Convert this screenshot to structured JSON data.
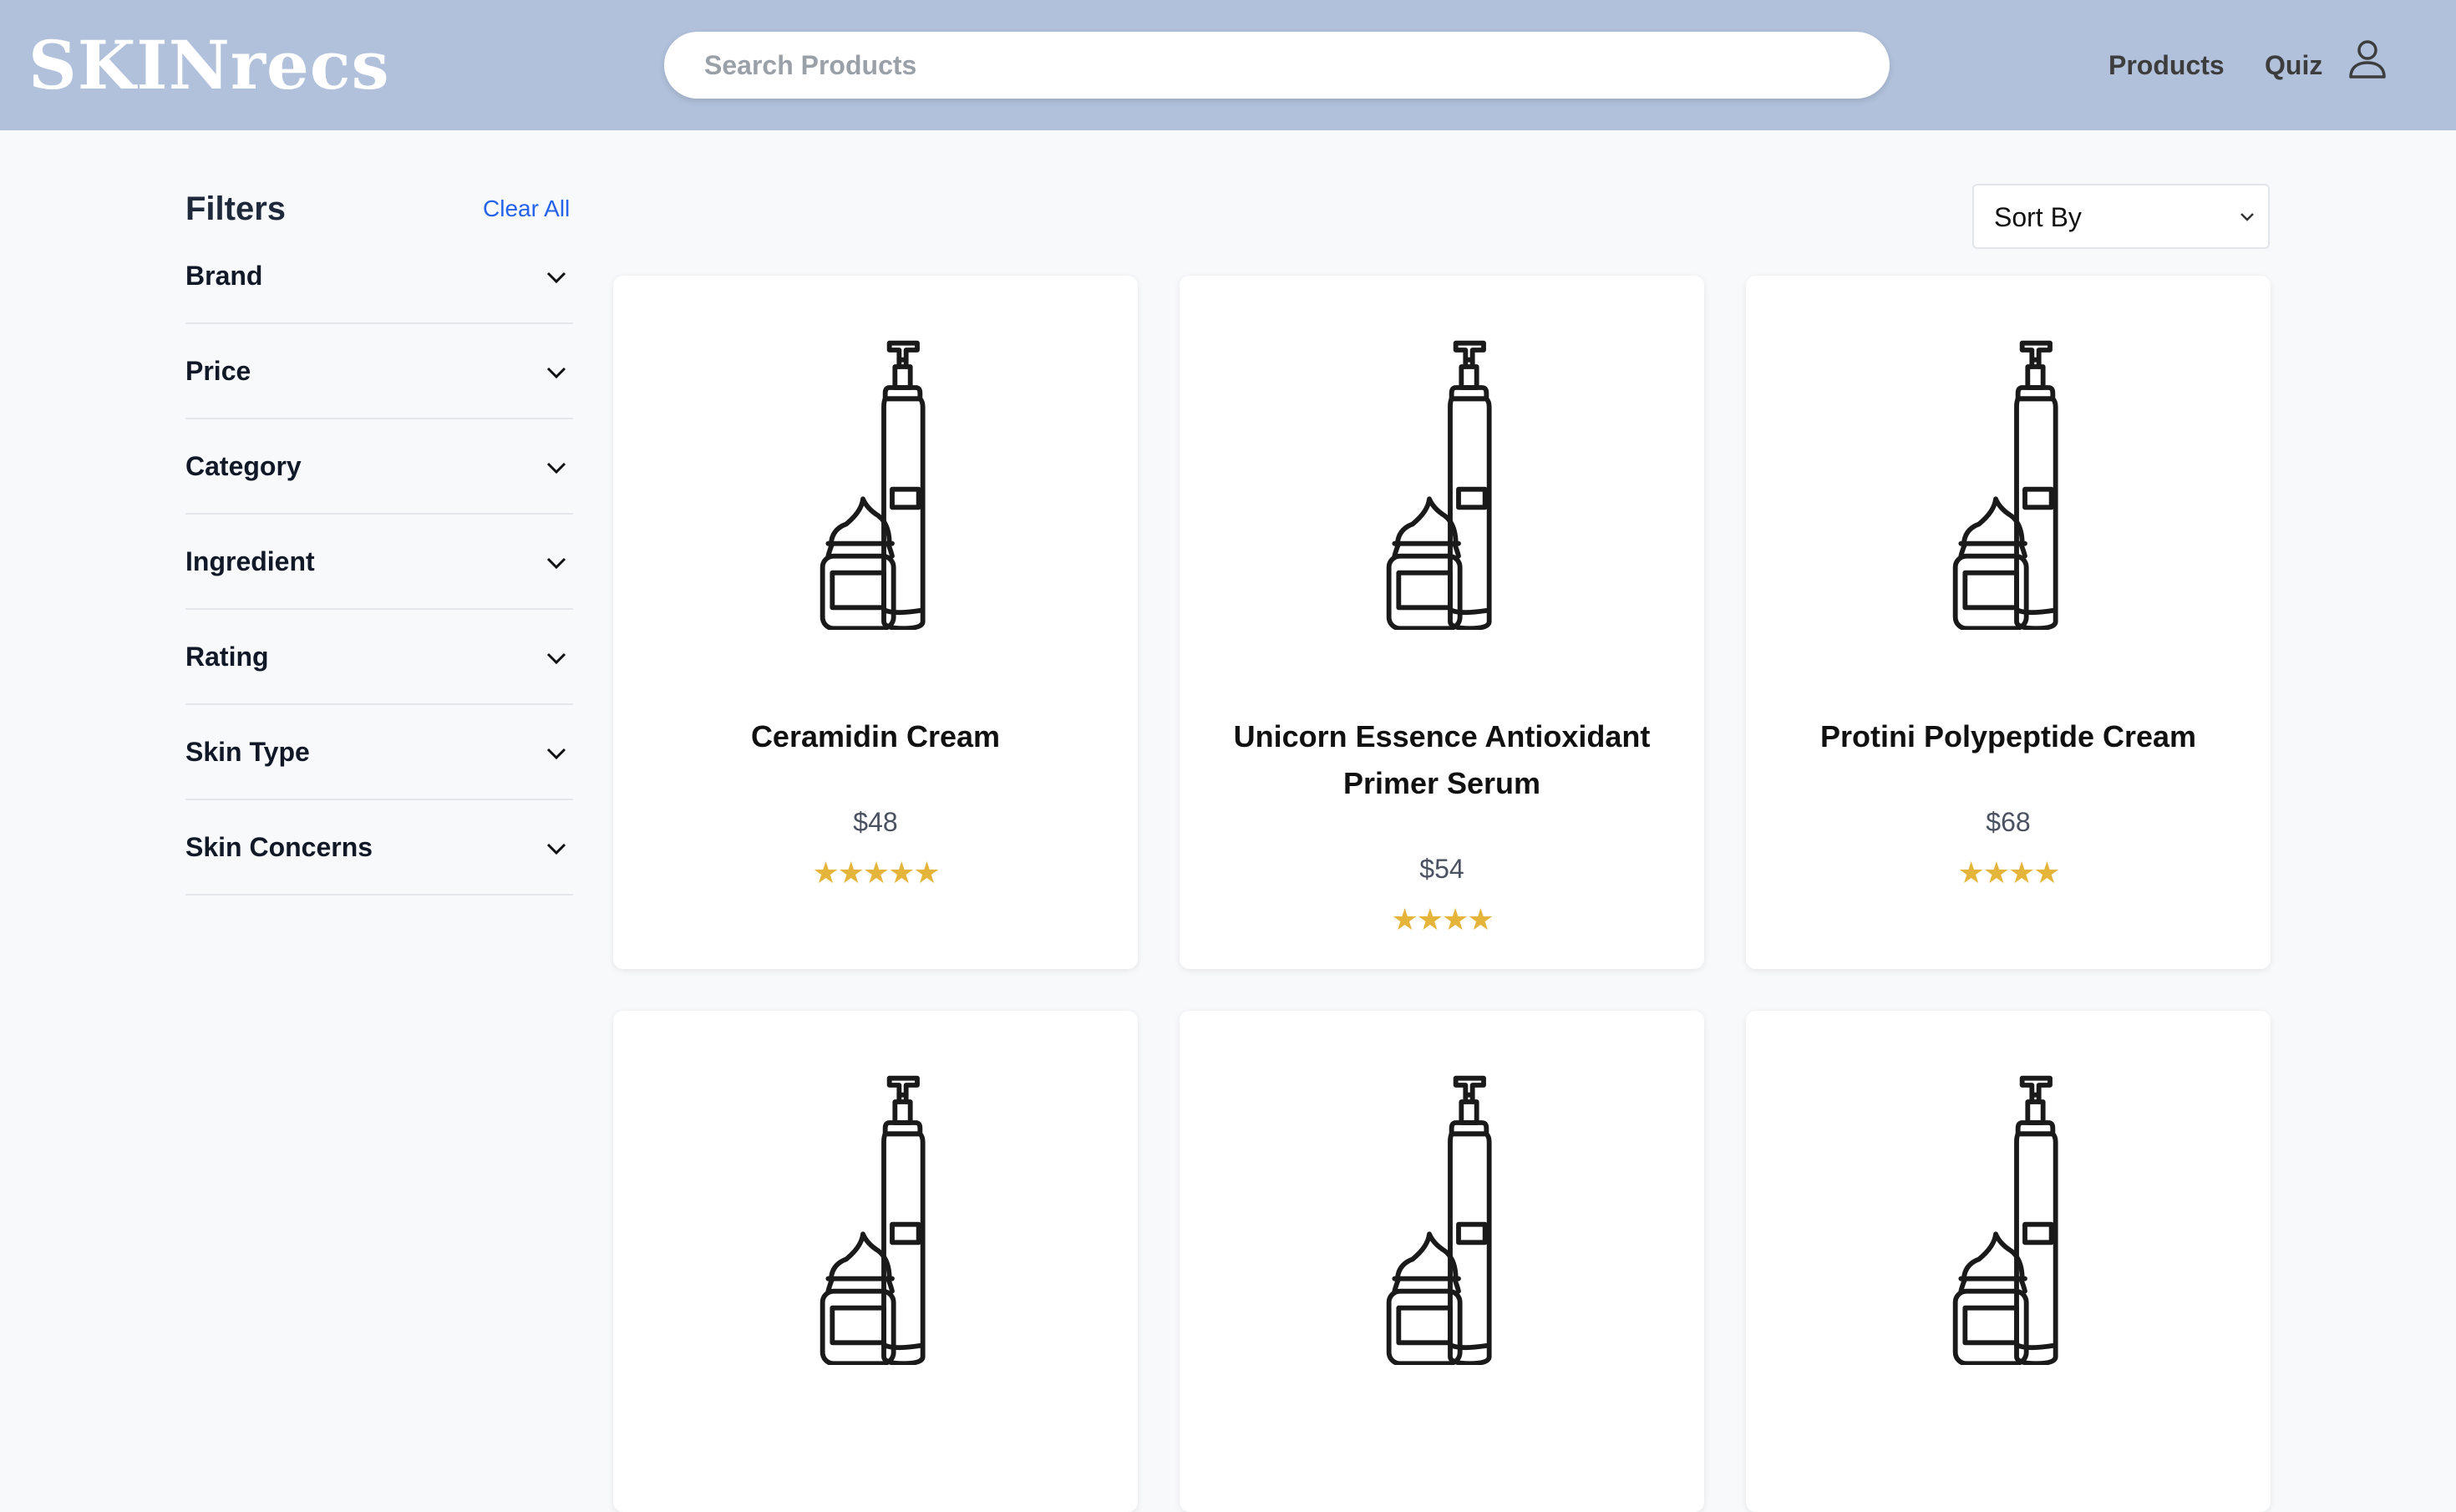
{
  "header": {
    "logo": "SKINrecs",
    "search_placeholder": "Search Products",
    "nav": {
      "products": "Products",
      "quiz": "Quiz"
    },
    "user_icon": "user-icon"
  },
  "sidebar": {
    "title": "Filters",
    "clear_all": "Clear All",
    "filters": [
      {
        "label": "Brand"
      },
      {
        "label": "Price"
      },
      {
        "label": "Category"
      },
      {
        "label": "Ingredient"
      },
      {
        "label": "Rating"
      },
      {
        "label": "Skin Type"
      },
      {
        "label": "Skin Concerns"
      }
    ]
  },
  "sort": {
    "label": "Sort By"
  },
  "products": [
    {
      "name": "Ceramidin Cream",
      "price": "$48",
      "stars": "★★★★★",
      "rating": 5
    },
    {
      "name": "Unicorn Essence Antioxidant Primer Serum",
      "price": "$54",
      "stars": "★★★★",
      "rating": 4
    },
    {
      "name": "Protini Polypeptide Cream",
      "price": "$68",
      "stars": "★★★★",
      "rating": 4
    },
    {
      "name": "",
      "price": "",
      "stars": ""
    },
    {
      "name": "",
      "price": "",
      "stars": ""
    },
    {
      "name": "",
      "price": "",
      "stars": ""
    }
  ],
  "colors": {
    "header_bg": "#b1c1db",
    "link_blue": "#2563eb",
    "star_gold": "#e5b43a"
  }
}
